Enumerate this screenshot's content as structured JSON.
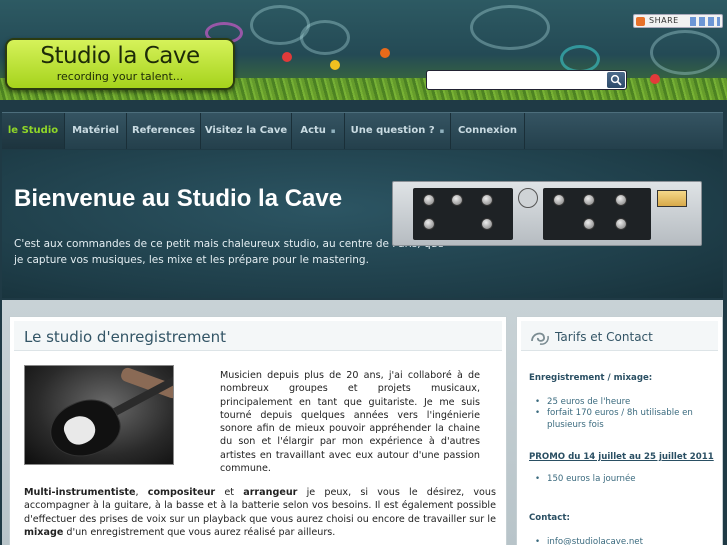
{
  "header": {
    "logo_title": "Studio la Cave",
    "logo_subtitle": "recording your talent...",
    "share_label": "SHARE",
    "search": {
      "placeholder": "",
      "value": ""
    }
  },
  "nav": {
    "items": [
      {
        "label": "le Studio",
        "active": true,
        "dropdown": false
      },
      {
        "label": "Matériel",
        "active": false,
        "dropdown": false
      },
      {
        "label": "References",
        "active": false,
        "dropdown": false
      },
      {
        "label": "Visitez la Cave",
        "active": false,
        "dropdown": false
      },
      {
        "label": "Actu",
        "active": false,
        "dropdown": true
      },
      {
        "label": "Une question ?",
        "active": false,
        "dropdown": true
      },
      {
        "label": "Connexion",
        "active": false,
        "dropdown": false
      }
    ],
    "dropdown_glyph": "▪"
  },
  "banner": {
    "title": "Bienvenue au Studio la Cave",
    "text": "C'est aux commandes de ce petit mais chaleureux studio, au centre de Paris, que je capture vos musiques, les mixe et les prépare pour le mastering."
  },
  "main": {
    "title": "Le studio d'enregistrement",
    "intro": "Musicien depuis plus de 20 ans, j'ai collaboré à de nombreux groupes et projets musicaux, principalement en tant que guitariste. Je me suis tourné depuis quelques années vers l'ingénierie sonore afin de mieux pouvoir appréhender la chaine du son et l'élargir par mon expérience à d'autres artistes en travaillant avec eux autour d'une passion commune.",
    "body": {
      "b1": "Multi-instrumentiste",
      "s1": ", ",
      "b2": "compositeur",
      "s2": " et ",
      "b3": "arrangeur",
      "s3": " je peux, si vous le désirez, vous accompagner à la guitare, à la basse et à la batterie selon vos besoins. Il est également possible d'effectuer des prises de voix sur un playback que vous aurez choisi ou encore de travailler sur le ",
      "b4": "mixage",
      "s4": " d'un enregistrement que vous aurez réalisé par ailleurs."
    }
  },
  "sidebar": {
    "title": "Tarifs et Contact",
    "section1": {
      "heading": "Enregistrement / mixage:",
      "items": [
        "25 euros de l'heure",
        "forfait 170 euros / 8h utilisable en plusieurs fois"
      ]
    },
    "section2": {
      "heading": "PROMO du 14 juillet au 25 juillet 2011",
      "items": [
        "150 euros la journée"
      ]
    },
    "section3": {
      "heading": "Contact:",
      "items": [
        "info@studiolacave.net"
      ]
    }
  },
  "colors": {
    "nav_active": "#8fd628",
    "logo_green": "#a6d31c",
    "heading_blue": "#2a4f63"
  }
}
